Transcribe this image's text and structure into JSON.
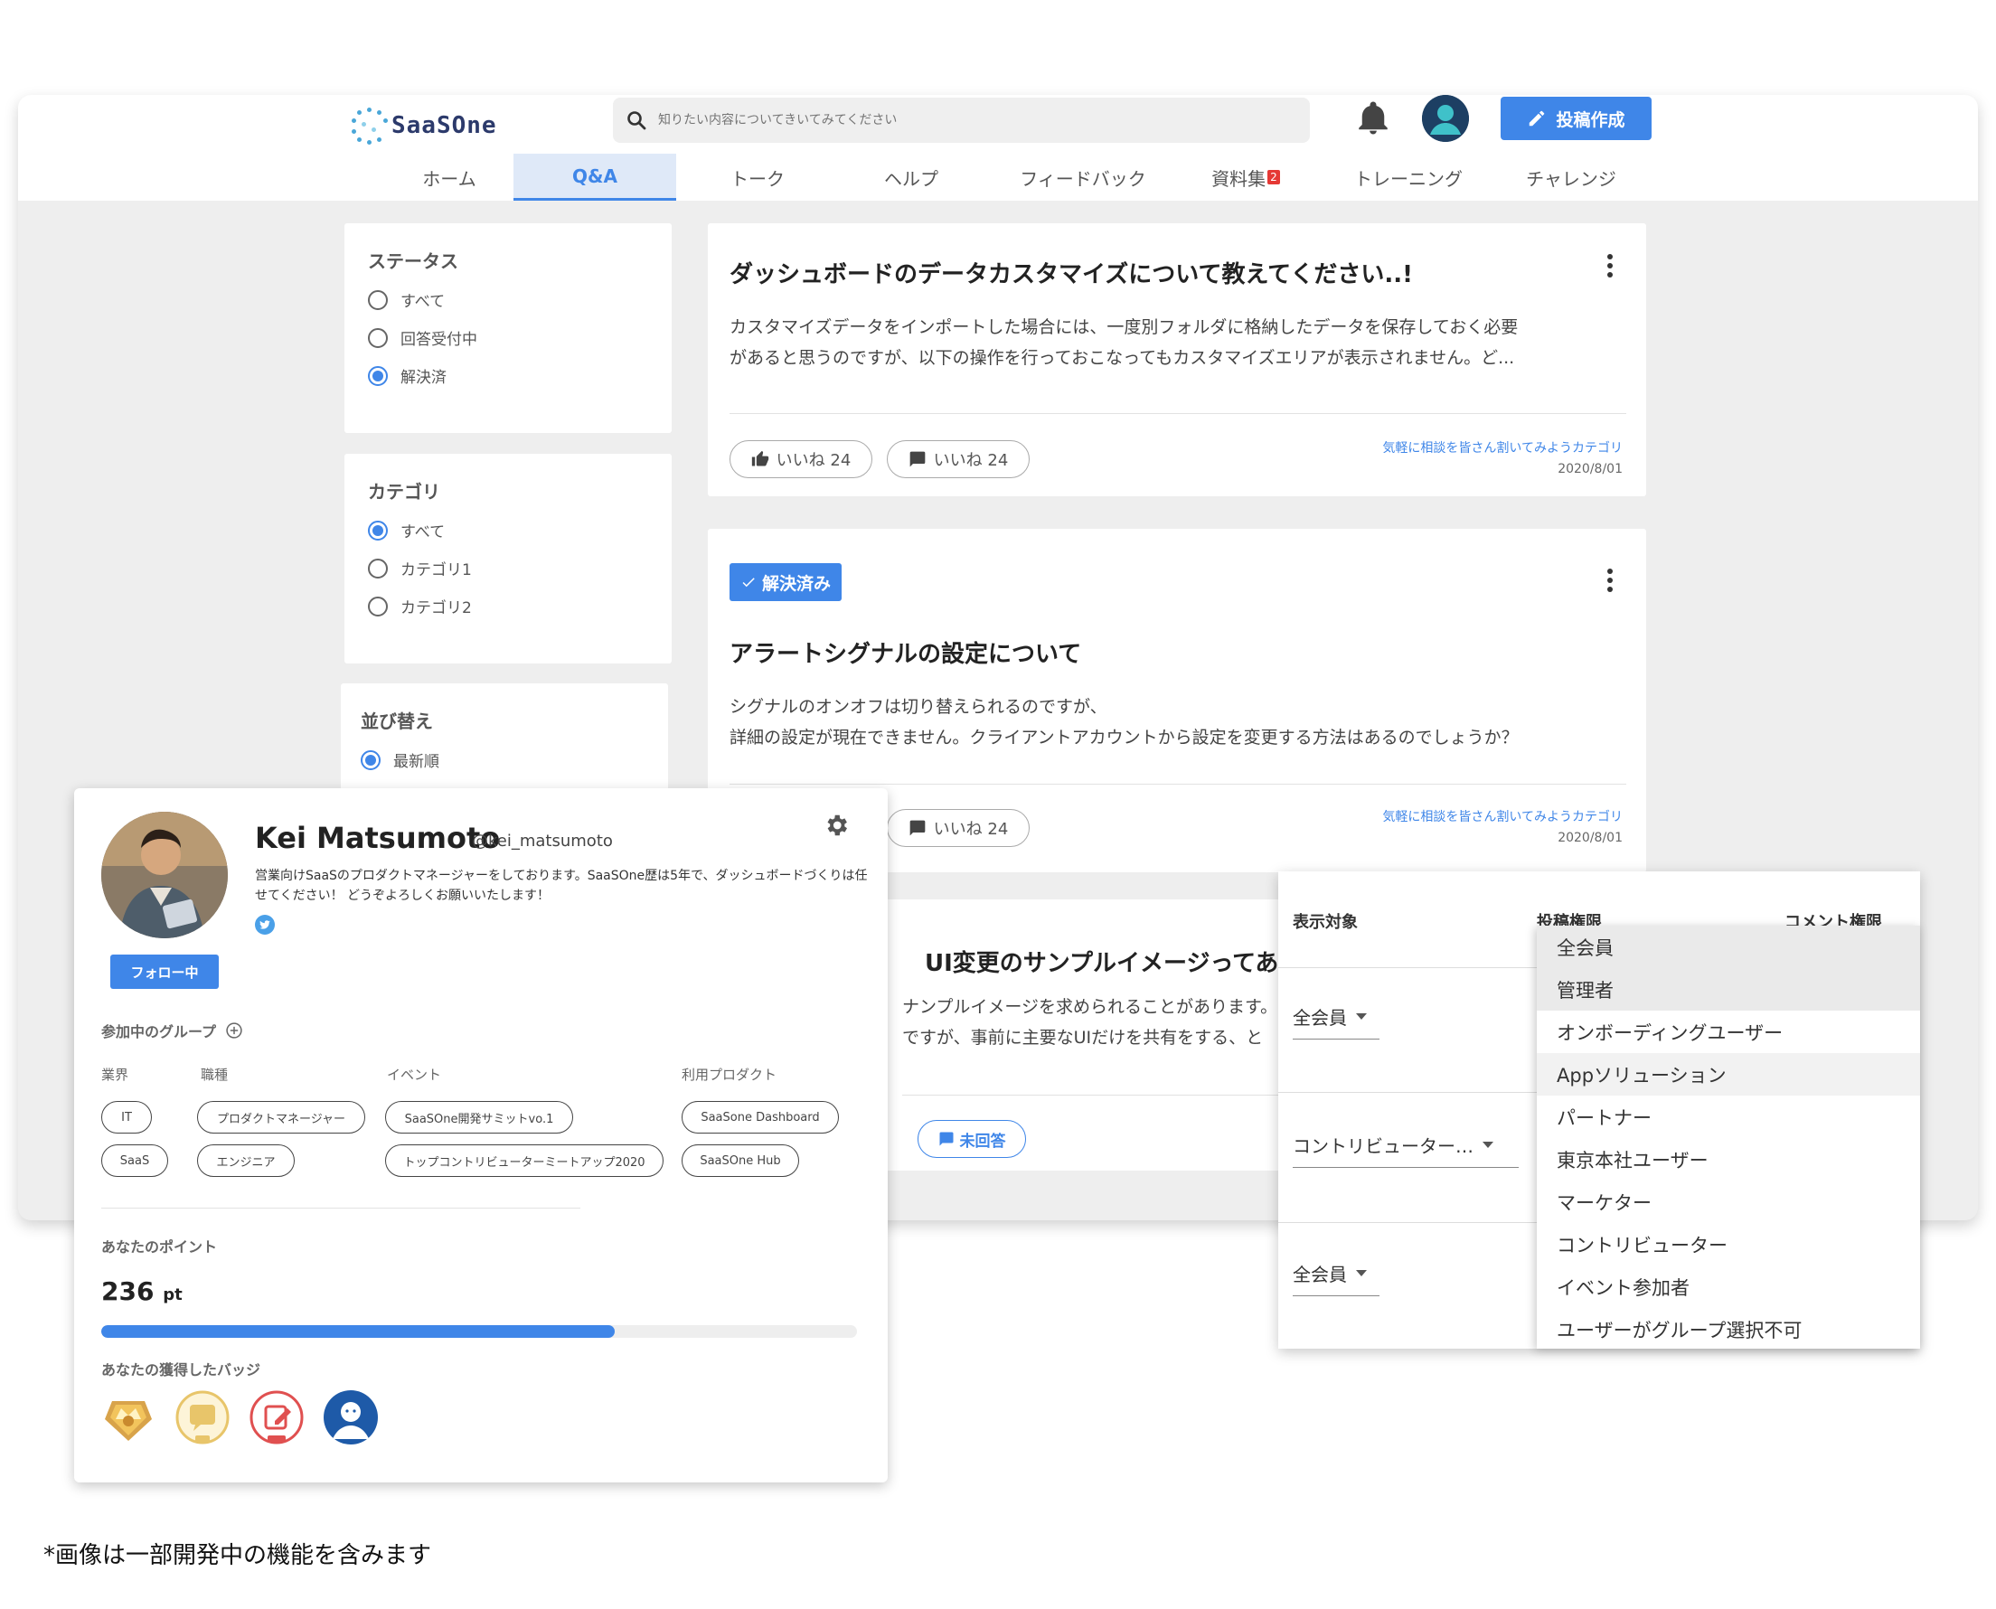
{
  "header": {
    "logo": "SaaSOne",
    "search_placeholder": "知りたい内容についてきいてみてください",
    "post_button": "投稿作成"
  },
  "nav": {
    "items": [
      {
        "label": "ホーム"
      },
      {
        "label": "Q&A"
      },
      {
        "label": "トーク"
      },
      {
        "label": "ヘルプ"
      },
      {
        "label": "フィードバック"
      },
      {
        "label": "資料集",
        "badge": "2"
      },
      {
        "label": "トレーニング"
      },
      {
        "label": "チャレンジ"
      }
    ],
    "active": "Q&A"
  },
  "filters": {
    "status": {
      "title": "ステータス",
      "options": [
        "すべて",
        "回答受付中",
        "解決済"
      ],
      "selected": "解決済"
    },
    "category": {
      "title": "カテゴリ",
      "options": [
        "すべて",
        "カテゴリ1",
        "カテゴリ2"
      ],
      "selected": "すべて"
    },
    "sort": {
      "title": "並び替え",
      "options": [
        "最新順"
      ],
      "selected": "最新順"
    }
  },
  "posts": [
    {
      "title": "ダッシュボードのデータカスタマイズについて教えてください..!",
      "body_line1": "カスタマイズデータをインポートした場合には、一度別フォルダに格納したデータを保存しておく必要",
      "body_line2": "があると思うのですが、以下の操作を行っておこなってもカスタマイズエリアが表示されません。ど...",
      "likes": "いいね 24",
      "comments": "いいね 24",
      "category": "気軽に相談を皆さん割いてみようカテゴリ",
      "date": "2020/8/01"
    },
    {
      "badge": "解決済み",
      "title": "アラートシグナルの設定について",
      "body_line1": "シグナルのオンオフは切り替えられるのですが、",
      "body_line2": "詳細の設定が現在できません。クライアントアカウントから設定を変更する方法はあるのでしょうか？",
      "comments": "いいね 24",
      "category": "気軽に相談を皆さん割いてみようカテゴリ",
      "date": "2020/8/01"
    },
    {
      "title": "UI変更のサンプルイメージってあり",
      "body_line1": "ナンプルイメージを求められることがあります。",
      "body_line2": "ですが、事前に主要なUIだけを共有をする、と",
      "status": "未回答"
    }
  ],
  "profile": {
    "name": "Kei Matsumoto",
    "handle": "@kei_matsumoto",
    "bio": "営業向けSaaSのプロダクトマネージャーをしております。SaaSOne歴は5年で、ダッシュボードづくりは任せてください！ どうぞよろしくお願いいたします！",
    "follow": "フォロー中",
    "groups_label": "参加中のグループ",
    "columns": {
      "industry": "業界",
      "role": "職種",
      "event": "イベント",
      "product": "利用プロダクト"
    },
    "industry_tags": [
      "IT",
      "SaaS"
    ],
    "role_tags": [
      "プロダクトマネージャー",
      "エンジニア"
    ],
    "event_tags": [
      "SaaSOne開発サミットvo.1",
      "トップコントリビューターミートアップ2020"
    ],
    "product_tags": [
      "SaaSone Dashboard",
      "SaaSOne Hub"
    ],
    "points_label": "あなたのポイント",
    "points": "236",
    "points_unit": "pt",
    "points_progress": 0.68,
    "badges_label": "あなたの獲得したバッジ",
    "badges": [
      "crown-badge",
      "comment-300-badge",
      "post-1000-badge",
      "avatar-badge"
    ]
  },
  "permissions": {
    "headers": {
      "target": "表示対象",
      "post": "投稿権限",
      "comment": "コメント権限"
    },
    "rows": [
      "全会員",
      "コントリビューター…",
      "全会員"
    ],
    "dropdown": [
      "全会員",
      "管理者",
      "オンボーディングユーザー",
      "Appソリューション",
      "パートナー",
      "東京本社ユーザー",
      "マーケター",
      "コントリビューター",
      "イベント参加者",
      "ユーザーがグループ選択不可"
    ]
  },
  "footnote": "*画像は一部開発中の機能を含みます",
  "colors": {
    "accent": "#3f86e8",
    "badge_red": "#e53935",
    "background": "#eeeeee"
  }
}
